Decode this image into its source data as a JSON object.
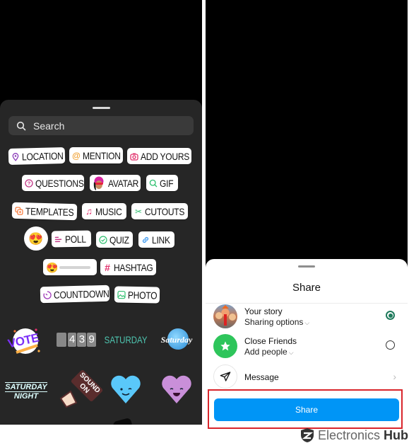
{
  "left_panel": {
    "search": {
      "placeholder": "Search",
      "icon": "search-icon"
    },
    "chips": [
      {
        "id": "location",
        "label": "LOCATION",
        "icon": "location-pin-icon",
        "color": "#8a3ab9"
      },
      {
        "id": "mention",
        "label": "MENTION",
        "icon": "at-sign-icon",
        "color": "#f0a030"
      },
      {
        "id": "add-yours",
        "label": "ADD YOURS",
        "icon": "camera-icon",
        "color": "#e1306c"
      },
      {
        "id": "questions",
        "label": "QUESTIONS",
        "icon": "question-icon",
        "color": "#c13584"
      },
      {
        "id": "avatar",
        "label": "AVATAR",
        "icon": "avatar-icon",
        "color": "#d6249f"
      },
      {
        "id": "gif",
        "label": "GIF",
        "icon": "search-icon",
        "color": "#2dbf6e"
      },
      {
        "id": "templates",
        "label": "TEMPLATES",
        "icon": "templates-icon",
        "color": "#f77737"
      },
      {
        "id": "music",
        "label": "MUSIC",
        "icon": "music-note-icon",
        "color": "#e1306c"
      },
      {
        "id": "cutouts",
        "label": "CUTOUTS",
        "icon": "scissors-icon",
        "color": "#2dbf6e"
      },
      {
        "id": "poll",
        "label": "POLL",
        "icon": "poll-icon",
        "color": "#c13584"
      },
      {
        "id": "quiz",
        "label": "QUIZ",
        "icon": "check-circle-icon",
        "color": "#2dbf6e"
      },
      {
        "id": "link",
        "label": "LINK",
        "icon": "link-icon",
        "color": "#3897f0"
      },
      {
        "id": "hashtag",
        "label": "HASHTAG",
        "icon": "hashtag-icon",
        "color": "#e1306c"
      },
      {
        "id": "countdown",
        "label": "COUNTDOWN",
        "icon": "countdown-icon",
        "color": "#a03ab9"
      },
      {
        "id": "photo",
        "label": "PHOTO",
        "icon": "photo-icon",
        "color": "#2dbf6e"
      }
    ],
    "emoji_reaction": "😍",
    "slider_emoji": "😍",
    "stickers": {
      "vote": "VOTE",
      "clock_digits": [
        "4",
        "3",
        "9"
      ],
      "saturday": "SATURDAY",
      "saturday_script": "Saturday",
      "saturday_night_1": "SATURDAY",
      "saturday_night_2": "NIGHT",
      "sound_on_1": "SOUND",
      "sound_on_2": "ON"
    }
  },
  "right_panel": {
    "sheet_title": "Share",
    "options": [
      {
        "title": "Your story",
        "subtitle": "Sharing options",
        "selected": true
      },
      {
        "title": "Close Friends",
        "subtitle": "Add people",
        "selected": false
      },
      {
        "title": "Message"
      }
    ],
    "share_button": "Share",
    "accent_color": "#0095f6",
    "radio_color": "#1f7a5c"
  },
  "watermark": {
    "brand1": "Electronics",
    "brand2": "Hub"
  }
}
